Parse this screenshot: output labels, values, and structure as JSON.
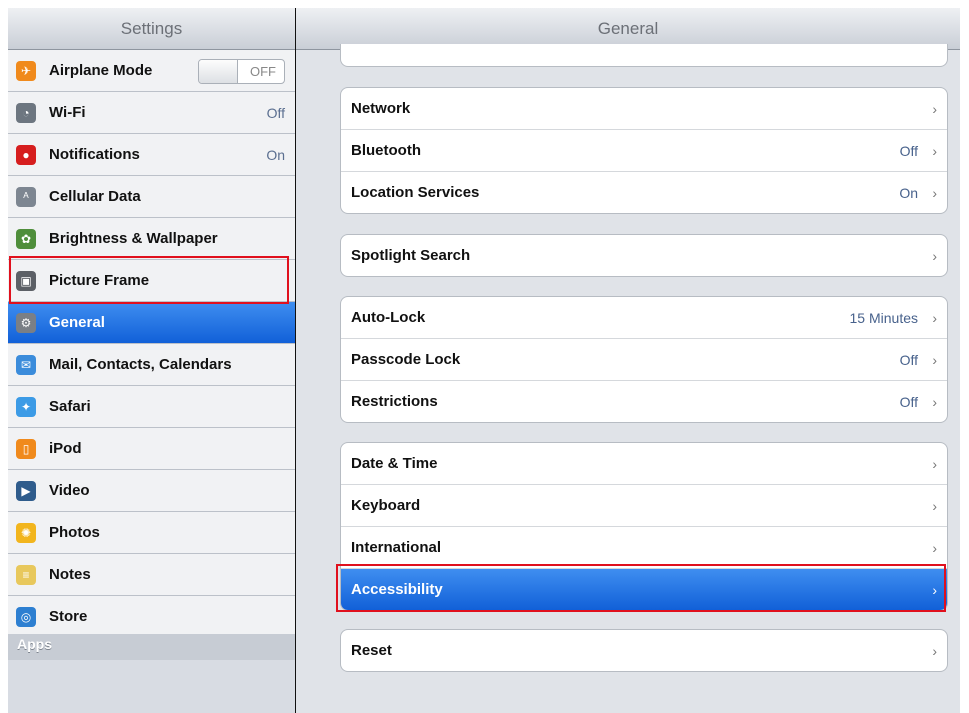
{
  "sidebar": {
    "title": "Settings",
    "items": [
      {
        "label": "Airplane Mode",
        "toggle": "OFF",
        "icon": "airplane-icon",
        "color": "#f08a1c"
      },
      {
        "label": "Wi-Fi",
        "value": "Off",
        "icon": "wifi-icon",
        "color": "#6d7680"
      },
      {
        "label": "Notifications",
        "value": "On",
        "icon": "notifications-icon",
        "color": "#d61e1e"
      },
      {
        "label": "Cellular Data",
        "icon": "cellular-data-icon",
        "color": "#7d8691"
      },
      {
        "label": "Brightness & Wallpaper",
        "icon": "brightness-wallpaper-icon",
        "color": "#4f8e3b"
      },
      {
        "label": "Picture Frame",
        "icon": "picture-frame-icon",
        "color": "#5c6066"
      },
      {
        "label": "General",
        "icon": "gear-icon",
        "color": "#7a7f86",
        "selected": true
      },
      {
        "label": "Mail, Contacts, Calendars",
        "icon": "mail-icon",
        "color": "#3b8cdb"
      },
      {
        "label": "Safari",
        "icon": "safari-icon",
        "color": "#3c9be6"
      },
      {
        "label": "iPod",
        "icon": "ipod-icon",
        "color": "#f08a1c"
      },
      {
        "label": "Video",
        "icon": "video-icon",
        "color": "#2f5c8c"
      },
      {
        "label": "Photos",
        "icon": "photos-icon",
        "color": "#f2b51d"
      },
      {
        "label": "Notes",
        "icon": "notes-icon",
        "color": "#e8c85c"
      },
      {
        "label": "Store",
        "icon": "store-icon",
        "color": "#2d7fd1"
      }
    ],
    "apps_header": "Apps"
  },
  "main": {
    "title": "General",
    "groups": [
      {
        "rows": [
          {
            "label": "Network"
          },
          {
            "label": "Bluetooth",
            "value": "Off"
          },
          {
            "label": "Location Services",
            "value": "On"
          }
        ]
      },
      {
        "rows": [
          {
            "label": "Spotlight Search"
          }
        ]
      },
      {
        "rows": [
          {
            "label": "Auto-Lock",
            "value": "15 Minutes"
          },
          {
            "label": "Passcode Lock",
            "value": "Off"
          },
          {
            "label": "Restrictions",
            "value": "Off"
          }
        ]
      },
      {
        "rows": [
          {
            "label": "Date & Time"
          },
          {
            "label": "Keyboard"
          },
          {
            "label": "International"
          },
          {
            "label": "Accessibility",
            "selected": true
          }
        ]
      },
      {
        "rows": [
          {
            "label": "Reset"
          }
        ]
      }
    ]
  },
  "colors": {
    "selection": "#1a6fe2",
    "highlight": "#e0101d"
  }
}
